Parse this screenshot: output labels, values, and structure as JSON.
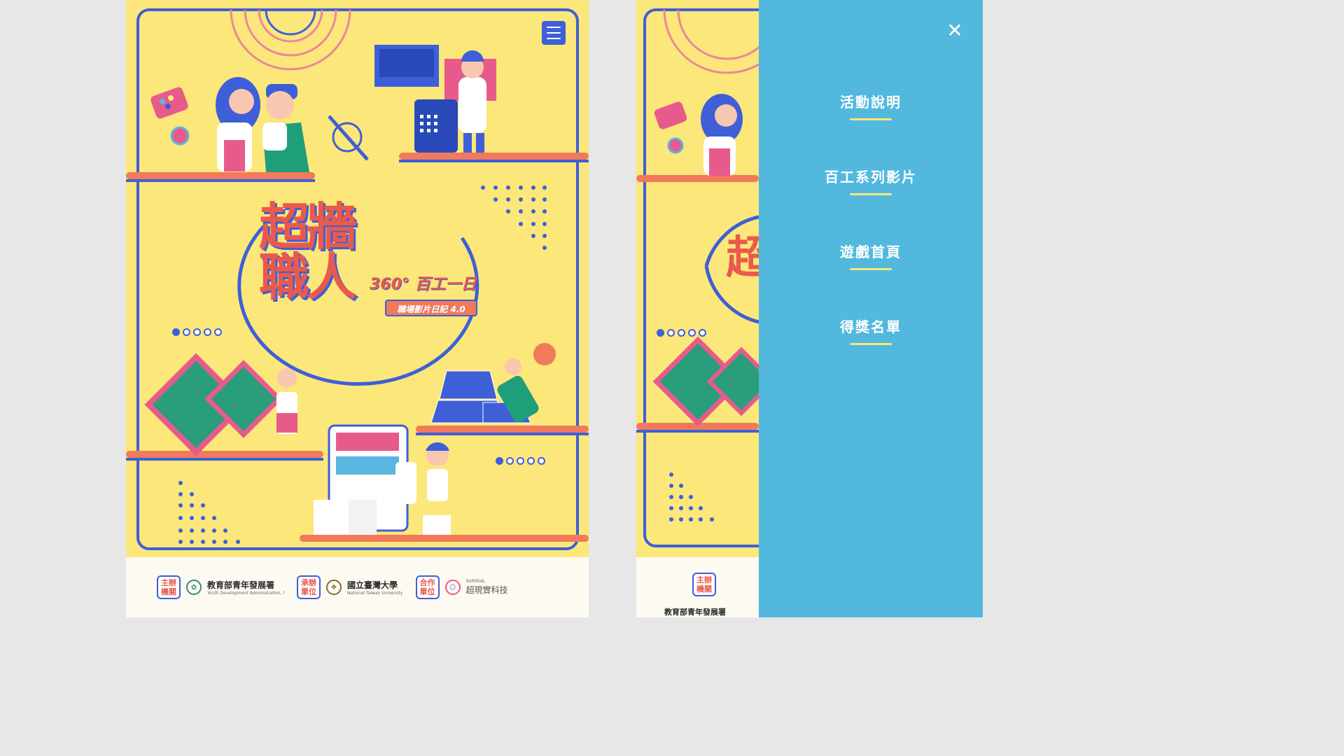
{
  "menu_icon": "hamburger-menu-icon",
  "carousel": {
    "left_top_dots": 5,
    "left_top_active": 0,
    "left_bottom_dots": 5,
    "left_bottom_active": 0
  },
  "hero": {
    "title_line1": "超牆",
    "title_line2": "職人",
    "subtitle": "360° 百工一日",
    "tag": "職場影片日記 4.0"
  },
  "footer": {
    "groups": [
      {
        "role": "主辦\n機關",
        "org": "教育部青年發展署",
        "org_sub": "Youth Development Administration, Ministry of Education"
      },
      {
        "role": "承辦\n單位",
        "org": "國立臺灣大學",
        "org_sub": "National Taiwan University"
      },
      {
        "role": "合作\n單位",
        "org": "超現實科技",
        "org_sub": "SURREAL"
      }
    ],
    "right_role": "主辦\n機關",
    "right_org": "教育部青年發展署"
  },
  "drawer": {
    "close_icon": "close-icon",
    "items": [
      {
        "label": "活動說明"
      },
      {
        "label": "百工系列影片"
      },
      {
        "label": "遊戲首頁"
      },
      {
        "label": "得獎名單"
      }
    ]
  },
  "colors": {
    "background_yellow": "#fbe77a",
    "accent_blue": "#3e5fd8",
    "coral": "#e95a4c",
    "drawer_blue": "#52b8dd"
  }
}
